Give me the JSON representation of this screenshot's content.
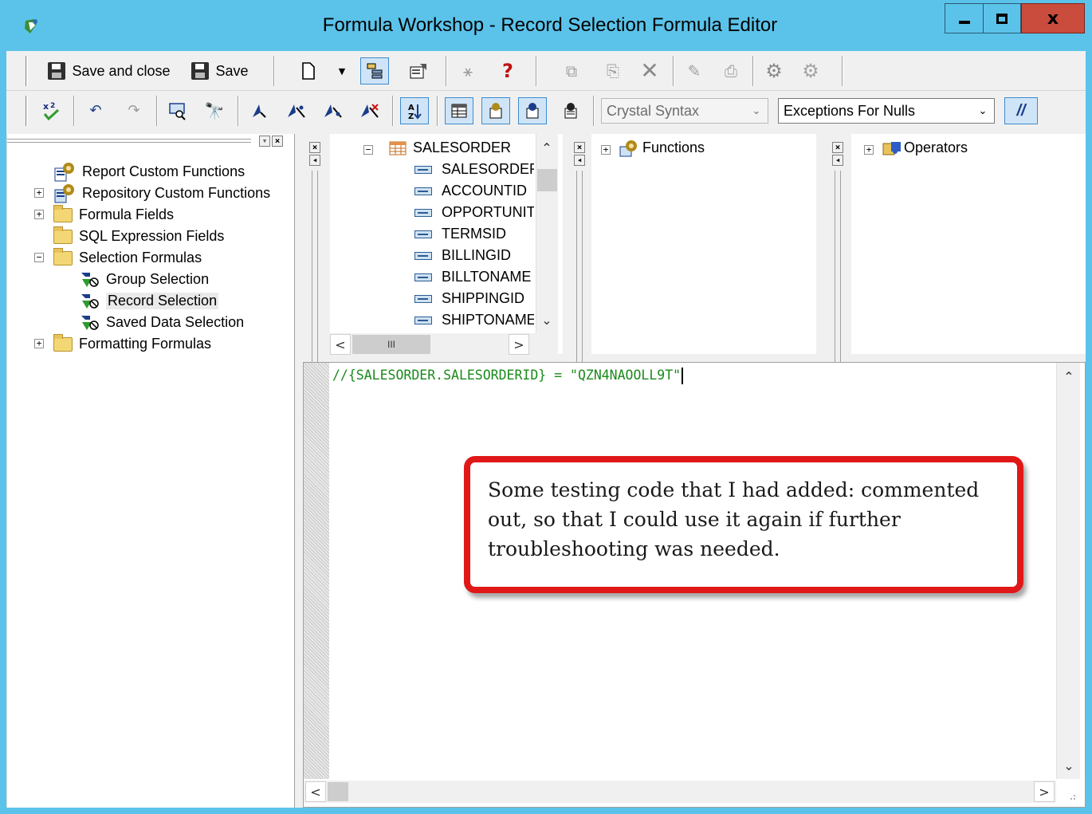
{
  "window": {
    "title": "Formula Workshop - Record Selection Formula Editor",
    "accent": "#5bc3ea",
    "close_color": "#c94c3c",
    "controls": {
      "minimize_icon": "minimize-icon",
      "maximize_icon": "maximize-icon",
      "close_icon": "close-icon",
      "close_glyph": "x"
    }
  },
  "toolbar1": {
    "save_and_close_label": "Save and close",
    "save_label": "Save",
    "icons": [
      "new-icon",
      "dropdown-arrow-icon",
      "toggle-tree-icon",
      "properties-icon",
      "formula-expert-icon",
      "help-icon",
      "copy-icon",
      "paste-icon",
      "delete-icon",
      "rename-icon",
      "add-to-repository-icon",
      "gear-icon",
      "gear-disabled-icon"
    ]
  },
  "toolbar2": {
    "syntax_select": {
      "value": "Crystal Syntax",
      "disabled": true
    },
    "null_select": {
      "value": "Exceptions For Nulls"
    },
    "comment_label": "//",
    "icons": [
      "check-icon",
      "undo-icon",
      "redo-icon",
      "browse-data-icon",
      "find-icon",
      "bookmark-icon",
      "next-bookmark-icon",
      "prev-bookmark-icon",
      "clear-bookmarks-icon",
      "sort-icon",
      "show-fields-icon",
      "show-functions-icon",
      "show-operators-icon",
      "toggle-text-icon"
    ]
  },
  "tree": {
    "items": [
      {
        "label": "Report Custom Functions",
        "level": 0,
        "expander": "",
        "icon": "gear-icon"
      },
      {
        "label": "Repository Custom Functions",
        "level": 0,
        "expander": "+",
        "icon": "repository-gear-icon"
      },
      {
        "label": "Formula Fields",
        "level": 0,
        "expander": "+",
        "icon": "folder-icon"
      },
      {
        "label": "SQL Expression Fields",
        "level": 0,
        "expander": "",
        "icon": "folder-icon"
      },
      {
        "label": "Selection Formulas",
        "level": 0,
        "expander": "−",
        "icon": "folder-icon"
      },
      {
        "label": "Group Selection",
        "level": 1,
        "expander": "",
        "icon": "selection-formula-icon"
      },
      {
        "label": "Record Selection",
        "level": 1,
        "expander": "",
        "icon": "selection-formula-icon",
        "selected": true
      },
      {
        "label": "Saved Data Selection",
        "level": 1,
        "expander": "",
        "icon": "selection-formula-icon"
      },
      {
        "label": "Formatting Formulas",
        "level": 0,
        "expander": "+",
        "icon": "folder-icon"
      }
    ]
  },
  "fields": {
    "table": "SALESORDER",
    "items": [
      "SALESORDERI",
      "ACCOUNTID",
      "OPPORTUNIT",
      "TERMSID",
      "BILLINGID",
      "BILLTONAME",
      "SHIPPINGID",
      "SHIPTONAME"
    ],
    "hscroll_mid": "III"
  },
  "functions": {
    "label": "Functions"
  },
  "operators": {
    "label": "Operators"
  },
  "editor": {
    "code": "//{SALESORDER.SALESORDERID} = \"QZN4NAOOLL9T\"",
    "code_color": "#1b8a1b"
  },
  "callout": {
    "text": "Some testing code that I had added: commented out, so that I could use it again if further troubleshooting was needed.",
    "border_color": "#e01818"
  }
}
